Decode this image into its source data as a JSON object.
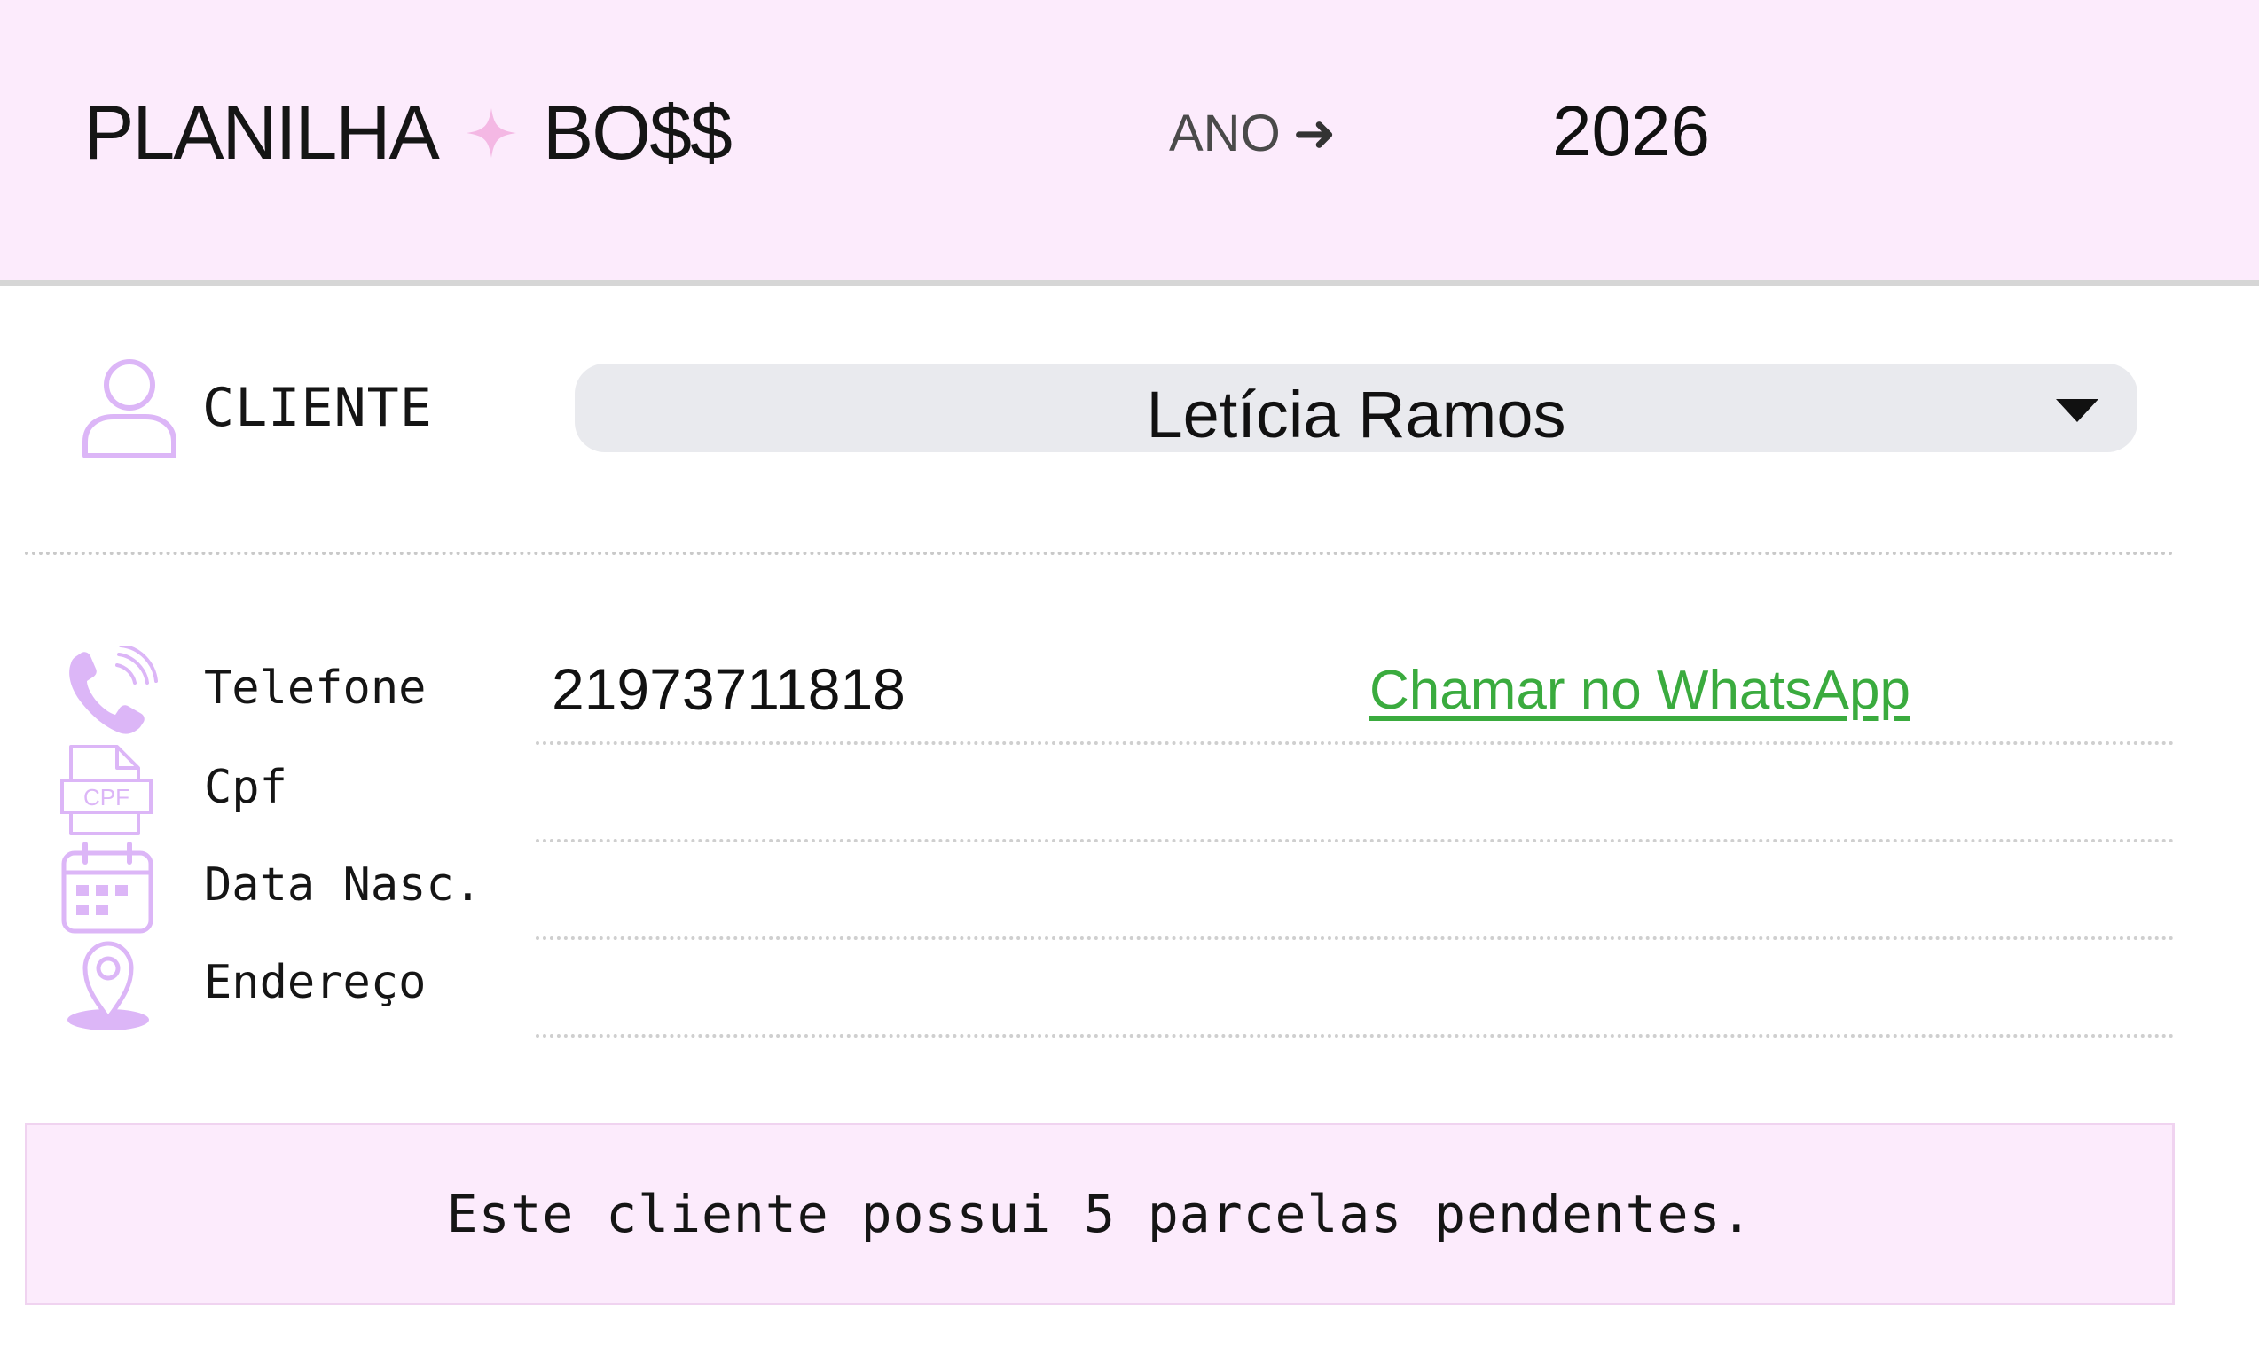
{
  "brand": {
    "left_word": "PLANILHA",
    "right_word": "BO$$",
    "star_color": "#f4b8e4"
  },
  "year": {
    "label": "ANO",
    "arrow": "➜",
    "value": "2026"
  },
  "client": {
    "icon": "user-outline-icon",
    "label": "CLIENTE",
    "selected": "Letícia Ramos",
    "caret_icon": "caret-down-icon"
  },
  "details": {
    "telefone": {
      "icon": "phone-ringing-icon",
      "label": "Telefone",
      "value": "21973711818"
    },
    "cpf": {
      "icon": "cpf-document-icon",
      "label": "Cpf",
      "value": ""
    },
    "data_nasc": {
      "icon": "calendar-icon",
      "label": "Data Nasc.",
      "value": ""
    },
    "endereco": {
      "icon": "map-pin-icon",
      "label": "Endereço",
      "value": ""
    }
  },
  "whatsapp": {
    "label": "Chamar no WhatsApp",
    "color": "#3aab3e"
  },
  "notice": {
    "text": "Este cliente possui 5 parcelas pendentes."
  },
  "colors": {
    "header_bg": "#fcebfc",
    "icon_lavender": "#dcb6f7",
    "select_bg": "#e9eaee"
  }
}
